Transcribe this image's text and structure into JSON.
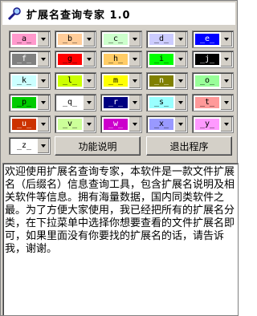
{
  "window": {
    "title": "扩展名查询专家  1.0"
  },
  "combos": [
    {
      "label": "_a_",
      "color": "#ff99cc"
    },
    {
      "label": "_b_",
      "color": "#ffcc99"
    },
    {
      "label": "_c_",
      "color": "#ccffcc"
    },
    {
      "label": "_d_",
      "color": "#ccccff"
    },
    {
      "label": "_e_",
      "color": "#0000ff"
    },
    {
      "label": "_f_",
      "color": "#808080"
    },
    {
      "label": "_g_",
      "color": "#ff0000"
    },
    {
      "label": "_h_",
      "color": "#ffcc66"
    },
    {
      "label": "_i_",
      "color": "#00ff00"
    },
    {
      "label": "_j_",
      "color": "#000000"
    },
    {
      "label": "_k_",
      "color": "#ccffff"
    },
    {
      "label": "_l_",
      "color": "#ccff00"
    },
    {
      "label": "_m_",
      "color": "#ffff00"
    },
    {
      "label": "_n_",
      "color": "#808000"
    },
    {
      "label": "_o_",
      "color": "#99ff99"
    },
    {
      "label": "_p_",
      "color": "#00cc00"
    },
    {
      "label": "_q_",
      "color": "#ffffff"
    },
    {
      "label": "_r_",
      "color": "#000080"
    },
    {
      "label": "_s_",
      "color": "#99ffff"
    },
    {
      "label": "_t_",
      "color": "#ff9999"
    },
    {
      "label": "_u_",
      "color": "#cc3300"
    },
    {
      "label": "_v_",
      "color": "#ccff99"
    },
    {
      "label": "_w_",
      "color": "#cc00cc"
    },
    {
      "label": "_x_",
      "color": "#9999ff"
    },
    {
      "label": "_y_",
      "color": "#ff99ff"
    },
    {
      "label": "_z_",
      "color": "#ffffff"
    }
  ],
  "buttons": {
    "help": "功能说明",
    "exit": "退出程序"
  },
  "description": "欢迎使用扩展名查询专家，本软件是一款文件扩展名（后缀名）信息查询工具，包含扩展名说明及相关软件等信息。拥有海量数据，国内同类软件之最。为了方便大家使用，我已经把所有的扩展名分类，在下拉菜单中选择你想要查看的文件扩展名即可，如果里面没有你要找的扩展名的话，请告诉我，谢谢。"
}
